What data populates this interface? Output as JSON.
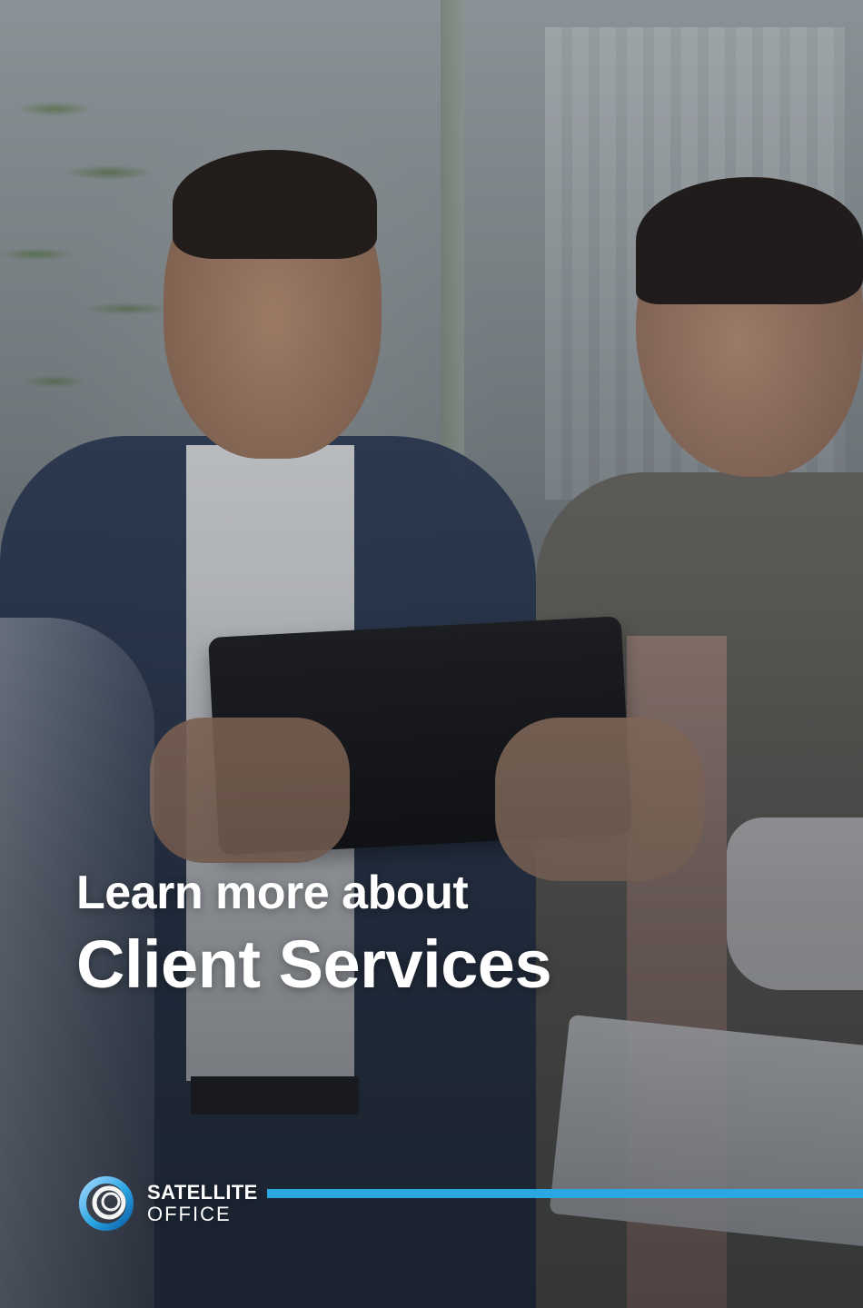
{
  "headline": {
    "line1": "Learn more about",
    "line2": "Client Services"
  },
  "brand": {
    "name_top": "SATELLITE",
    "name_bottom": "OFFICE",
    "icon": "satellite-office-logo-icon",
    "accent_color": "#2aa6e2"
  }
}
